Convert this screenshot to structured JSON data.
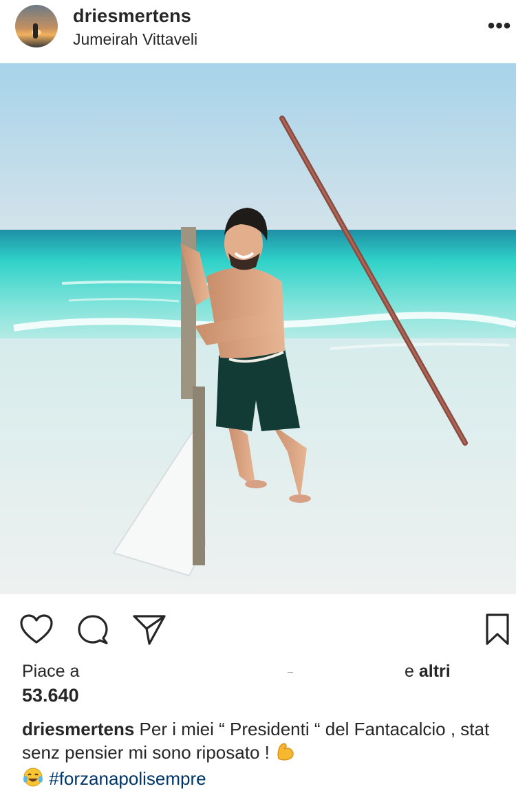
{
  "post": {
    "username": "driesmertens",
    "location": "Jumeirah Vittaveli",
    "more_icon": "more-horizontal-icon",
    "likes_prefix": "Piace a",
    "likes_suffix_e": "e",
    "likes_suffix_altri": "altri",
    "likes_count": "53.640",
    "caption_user": "driesmertens",
    "caption_text": "Per i miei “ Presidenti “ del Fantacalcio , stat senz pensier mi sono riposato !",
    "hashtag": "#forzanapolisempre",
    "emojis": [
      "flexed-biceps-emoji",
      "tears-of-joy-emoji"
    ]
  },
  "actions": {
    "like_icon": "heart-icon",
    "comment_icon": "comment-icon",
    "share_icon": "send-icon",
    "save_icon": "bookmark-icon"
  },
  "colors": {
    "text": "#262626",
    "hashtag": "#003569",
    "sky": "#a9d3ea",
    "sea": "#2fd0c8",
    "sand": "#e8eeee"
  }
}
